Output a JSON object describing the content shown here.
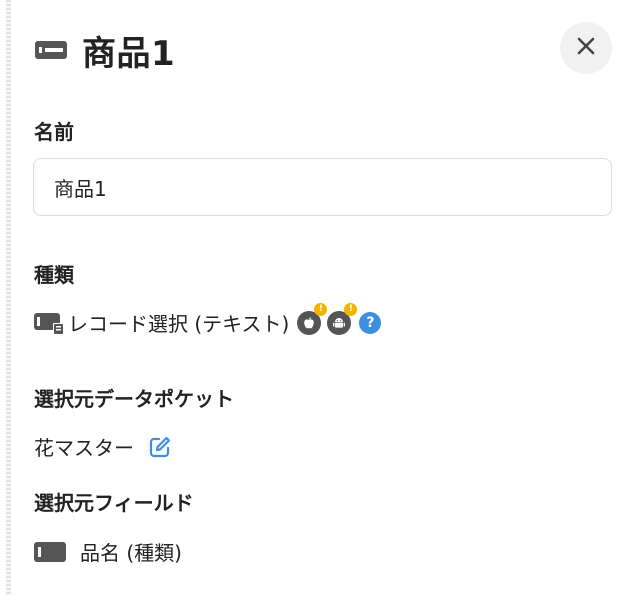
{
  "header": {
    "title": "商品1",
    "header_icon": "field-card-icon",
    "close_icon": "close-icon"
  },
  "name_section": {
    "label": "名前",
    "value": "商品1"
  },
  "type_section": {
    "label": "種類",
    "type_icon": "record-select-icon",
    "value": "レコード選択 (テキスト)",
    "badges": [
      {
        "icon": "apple-icon",
        "warning": "!"
      },
      {
        "icon": "android-icon",
        "warning": "!"
      }
    ],
    "help_icon": "help-icon",
    "help_text": "?"
  },
  "source_pocket_section": {
    "label": "選択元データポケット",
    "value": "花マスター",
    "edit_icon": "edit-icon"
  },
  "source_field_section": {
    "label": "選択元フィールド",
    "field_icon": "text-field-icon",
    "value": "品名 (種類)"
  },
  "colors": {
    "accent": "#3d8fe0",
    "warning": "#f5b400",
    "icon_dark": "#555555"
  }
}
